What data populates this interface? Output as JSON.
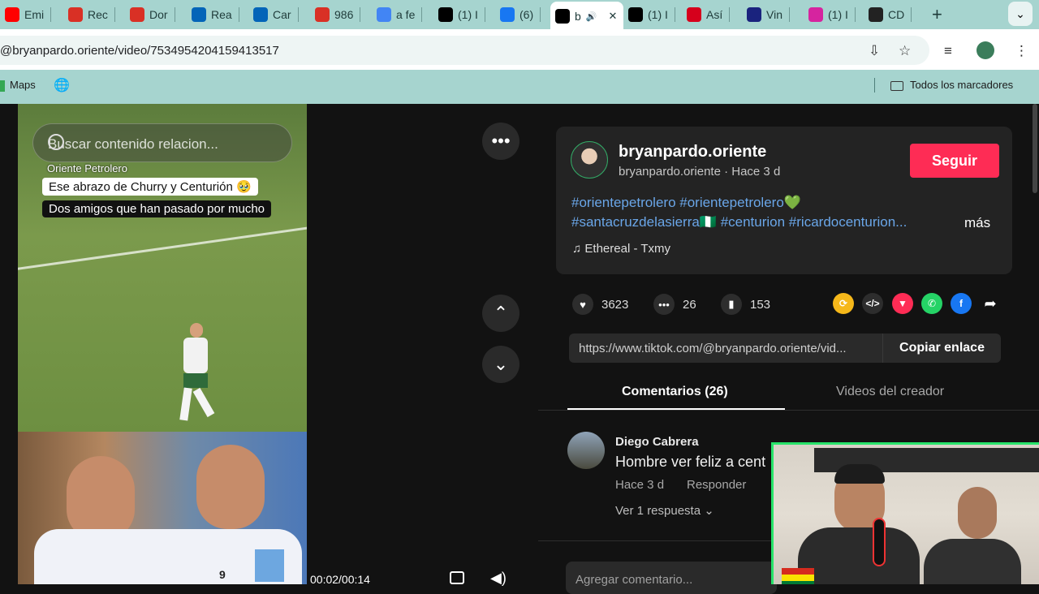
{
  "browser": {
    "tabs": [
      {
        "label": "Emi",
        "icon": "youtube-icon",
        "color": "#ff0000"
      },
      {
        "label": "Rec",
        "icon": "gmail-icon",
        "color": "#d93025"
      },
      {
        "label": "Dor",
        "icon": "gmail-icon",
        "color": "#d93025"
      },
      {
        "label": "Rea",
        "icon": "onedrive-icon",
        "color": "#0364b8"
      },
      {
        "label": "Car",
        "icon": "onedrive-icon",
        "color": "#0364b8"
      },
      {
        "label": "986",
        "icon": "gmail-icon",
        "color": "#d93025"
      },
      {
        "label": "a fe",
        "icon": "google-icon",
        "color": "#4285f4"
      },
      {
        "label": "(1) I",
        "icon": "x-icon",
        "color": "#000000"
      },
      {
        "label": "(6)",
        "icon": "facebook-icon",
        "color": "#1877f2"
      },
      {
        "label": "b",
        "icon": "tiktok-icon",
        "color": "#000000",
        "active": true
      },
      {
        "label": "(1) I",
        "icon": "x-icon",
        "color": "#000000"
      },
      {
        "label": "Así",
        "icon": "as-icon",
        "color": "#d6001c"
      },
      {
        "label": "Vin",
        "icon": "lm-icon",
        "color": "#1a237e"
      },
      {
        "label": "(1) I",
        "icon": "instagram-icon",
        "color": "#d6249f"
      },
      {
        "label": "CD",
        "icon": "365-icon",
        "color": "#222222"
      }
    ],
    "url": "@bryanpardo.oriente/video/7534954204159413517",
    "bookmarks": {
      "maps": "Maps",
      "all": "Todos los marcadores"
    }
  },
  "video": {
    "search_placeholder": "Buscar contenido relacion...",
    "label_team": "Oriente Petrolero",
    "caption1": "Ese abrazo de Churry y Centurión 🥹",
    "caption2": "Dos amigos que han pasado por mucho",
    "time": "00:02/00:14",
    "player_number": "9"
  },
  "post": {
    "username": "bryanpardo.oriente",
    "subtitle": "bryanpardo.oriente · Hace 3 d",
    "follow_label": "Seguir",
    "tags_line1": "#orientepetrolero #orientepetrolero💚",
    "tags_line2": "#santacruzdelasierra🇳🇬 #centurion #ricardocenturion...",
    "more_label": "más",
    "music": "♫  Ethereal - Txmy",
    "likes": "3623",
    "comments": "26",
    "saves": "153",
    "link": "https://www.tiktok.com/@bryanpardo.oriente/vid...",
    "copy_label": "Copiar enlace"
  },
  "tabs": {
    "comments": "Comentarios (26)",
    "creator": "Videos del creador"
  },
  "comment": {
    "name": "Diego Cabrera",
    "text": "Hombre ver feliz a cent",
    "time": "Hace 3 d",
    "reply": "Responder",
    "replies": "Ver 1 respuesta ⌄"
  },
  "add_comment_placeholder": "Agregar comentario..."
}
